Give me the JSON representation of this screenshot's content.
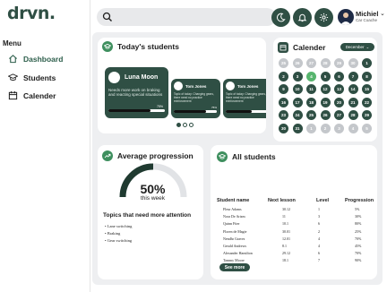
{
  "logo": "drvn.",
  "menu": {
    "title": "Menu",
    "items": [
      {
        "label": "Dashboard",
        "icon": "home-icon",
        "active": true
      },
      {
        "label": "Students",
        "icon": "graduation-cap-icon",
        "active": false
      },
      {
        "label": "Calender",
        "icon": "calendar-icon",
        "active": false
      }
    ]
  },
  "search": {
    "icon": "search-icon"
  },
  "topbar": {
    "buttons": [
      "moon-icon",
      "bell-icon",
      "gear-icon"
    ],
    "user": {
      "name": "Michiel",
      "role": "Car Coache",
      "chevron": "⌄"
    }
  },
  "todays_students": {
    "title": "Today's students",
    "cards": [
      {
        "name": "Luna Moon",
        "desc": "Needs more work on braking and reacting special situations",
        "progress_label": "75%",
        "progress": 0.75
      },
      {
        "name": "Tom Jones",
        "desc": "Topic of today: Changing gears, there need no practice reinforcement",
        "progress_label": "75%",
        "progress": 0.75
      },
      {
        "name": "Tom Jones",
        "desc": "Topic of today: Changing gears, there need no practice reinforcement",
        "progress_label": "",
        "progress": 0.6
      }
    ],
    "page_dots": 3,
    "active_dot": 0
  },
  "calendar": {
    "title": "Calender",
    "month": "December",
    "chevron": "⌄",
    "days": [
      {
        "d": "25",
        "type": "prev"
      },
      {
        "d": "26",
        "type": "prev"
      },
      {
        "d": "27",
        "type": "prev"
      },
      {
        "d": "28",
        "type": "prev"
      },
      {
        "d": "29",
        "type": "prev"
      },
      {
        "d": "30",
        "type": "prev"
      },
      {
        "d": "1",
        "type": "cur"
      },
      {
        "d": "2",
        "type": "cur"
      },
      {
        "d": "3",
        "type": "cur"
      },
      {
        "d": "4",
        "type": "today"
      },
      {
        "d": "5",
        "type": "cur"
      },
      {
        "d": "6",
        "type": "cur"
      },
      {
        "d": "7",
        "type": "cur"
      },
      {
        "d": "8",
        "type": "cur"
      },
      {
        "d": "9",
        "type": "cur"
      },
      {
        "d": "10",
        "type": "cur"
      },
      {
        "d": "11",
        "type": "cur"
      },
      {
        "d": "12",
        "type": "cur"
      },
      {
        "d": "13",
        "type": "cur"
      },
      {
        "d": "14",
        "type": "cur"
      },
      {
        "d": "15",
        "type": "cur"
      },
      {
        "d": "16",
        "type": "cur"
      },
      {
        "d": "17",
        "type": "cur"
      },
      {
        "d": "18",
        "type": "cur"
      },
      {
        "d": "19",
        "type": "cur"
      },
      {
        "d": "20",
        "type": "cur"
      },
      {
        "d": "21",
        "type": "cur"
      },
      {
        "d": "22",
        "type": "cur"
      },
      {
        "d": "23",
        "type": "cur"
      },
      {
        "d": "24",
        "type": "cur"
      },
      {
        "d": "25",
        "type": "cur"
      },
      {
        "d": "26",
        "type": "cur"
      },
      {
        "d": "27",
        "type": "cur"
      },
      {
        "d": "28",
        "type": "cur"
      },
      {
        "d": "29",
        "type": "cur"
      },
      {
        "d": "30",
        "type": "cur"
      },
      {
        "d": "31",
        "type": "cur"
      },
      {
        "d": "1",
        "type": "next"
      },
      {
        "d": "2",
        "type": "next"
      },
      {
        "d": "3",
        "type": "next"
      },
      {
        "d": "4",
        "type": "next"
      },
      {
        "d": "5",
        "type": "next"
      }
    ]
  },
  "average_progression": {
    "title": "Average progression",
    "value": 0.5,
    "value_label": "50%",
    "sub": "this week",
    "topics_title": "Topics that need more attention",
    "topics": [
      "• Lane switching",
      "• Braking",
      "• Gear switching"
    ]
  },
  "all_students": {
    "title": "All students",
    "columns": [
      "Student name",
      "Next lesson",
      "Level",
      "Progression"
    ],
    "rows": [
      [
        "Fleur Adams",
        "30.12",
        "1",
        "5%"
      ],
      [
        "Nora De Arizm",
        "11",
        "3",
        "30%"
      ],
      [
        "Quinn Fiter",
        "10.1",
        "6",
        "80%"
      ],
      [
        "Floren de Magie",
        "30.01",
        "2",
        "25%"
      ],
      [
        "Nendhr Graves",
        "12.01",
        "4",
        "70%"
      ],
      [
        "Gerald Andrews",
        "8.1",
        "4",
        "45%"
      ],
      [
        "Alexander Hamilton",
        "29.12",
        "6",
        "70%"
      ],
      [
        "Tammy Moore",
        "18.1",
        "7",
        "90%"
      ]
    ],
    "see_more": "See more"
  },
  "colors": {
    "brand": "#2f4f44",
    "accent": "#57b56e",
    "muted": "#c4c7cb",
    "panel": "#eeeff1"
  }
}
